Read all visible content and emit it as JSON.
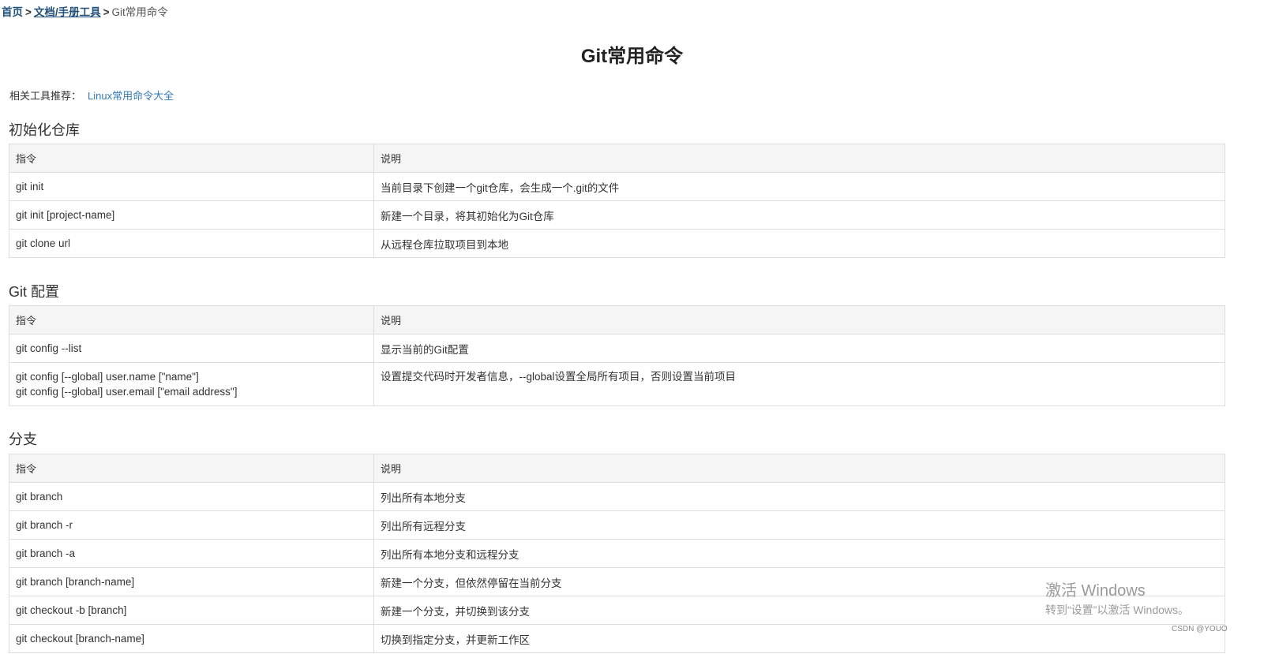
{
  "breadcrumb": {
    "home": "首页",
    "sep1": ">",
    "category": "文档/手册工具",
    "sep2": ">",
    "current": "Git常用命令"
  },
  "page_title": "Git常用命令",
  "related": {
    "label": "相关工具推荐：",
    "link": "Linux常用命令大全"
  },
  "table_headers": {
    "cmd": "指令",
    "desc": "说明"
  },
  "sections": [
    {
      "title": "初始化仓库",
      "rows": [
        {
          "cmd": "git init",
          "desc": "当前目录下创建一个git仓库，会生成一个.git的文件"
        },
        {
          "cmd": "git init [project-name]",
          "desc": "新建一个目录，将其初始化为Git仓库"
        },
        {
          "cmd": "git clone url",
          "desc": "从远程仓库拉取项目到本地"
        }
      ]
    },
    {
      "title": "Git 配置",
      "rows": [
        {
          "cmd": "git config --list",
          "desc": "显示当前的Git配置"
        },
        {
          "cmd_line1": "git config [--global] user.name [\"name\"]",
          "cmd_line2": "git config [--global] user.email [\"email address\"]",
          "desc": "设置提交代码时开发者信息，--global设置全局所有项目，否则设置当前项目"
        }
      ]
    },
    {
      "title": "分支",
      "rows": [
        {
          "cmd": "git branch",
          "desc": "列出所有本地分支"
        },
        {
          "cmd": "git branch -r",
          "desc": "列出所有远程分支"
        },
        {
          "cmd": "git branch -a",
          "desc": "列出所有本地分支和远程分支"
        },
        {
          "cmd": "git branch [branch-name]",
          "desc": "新建一个分支，但依然停留在当前分支"
        },
        {
          "cmd": "git checkout -b [branch]",
          "desc": "新建一个分支，并切换到该分支"
        },
        {
          "cmd": "git checkout [branch-name]",
          "desc": "切换到指定分支，并更新工作区"
        }
      ]
    }
  ],
  "watermark": {
    "title": "激活 Windows",
    "subtitle": "转到“设置”以激活 Windows。"
  },
  "csdn_mark": "CSDN @YOUO"
}
